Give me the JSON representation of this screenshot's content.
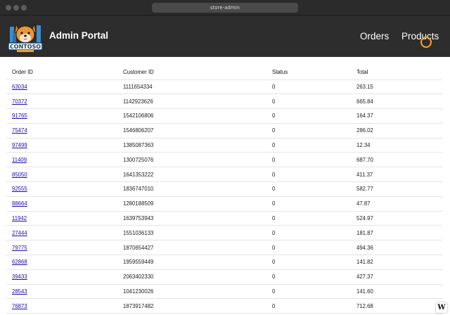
{
  "browser": {
    "address": "store-admin"
  },
  "header": {
    "logo_text": "CONTOSO",
    "title": "Admin Portal",
    "nav": {
      "orders": "Orders",
      "products": "Products"
    }
  },
  "table": {
    "columns": [
      "Order ID",
      "Customer ID",
      "Status",
      "Total"
    ],
    "rows": [
      {
        "order_id": "63034",
        "customer_id": "1111654334",
        "status": "0",
        "total": "263.15"
      },
      {
        "order_id": "70372",
        "customer_id": "1142923626",
        "status": "0",
        "total": "665.84"
      },
      {
        "order_id": "91765",
        "customer_id": "1542106806",
        "status": "0",
        "total": "164.37"
      },
      {
        "order_id": "75474",
        "customer_id": "1546806207",
        "status": "0",
        "total": "286.02"
      },
      {
        "order_id": "97499",
        "customer_id": "1385087363",
        "status": "0",
        "total": "12.34"
      },
      {
        "order_id": "11409",
        "customer_id": "1300725076",
        "status": "0",
        "total": "687.70"
      },
      {
        "order_id": "85050",
        "customer_id": "1641353222",
        "status": "0",
        "total": "411.37"
      },
      {
        "order_id": "92555",
        "customer_id": "1836747010",
        "status": "0",
        "total": "582.77"
      },
      {
        "order_id": "88664",
        "customer_id": "1280188509",
        "status": "0",
        "total": "47.87"
      },
      {
        "order_id": "11942",
        "customer_id": "1639753943",
        "status": "0",
        "total": "524.97"
      },
      {
        "order_id": "27444",
        "customer_id": "1551036133",
        "status": "0",
        "total": "181.87"
      },
      {
        "order_id": "79775",
        "customer_id": "1870654427",
        "status": "0",
        "total": "494.36"
      },
      {
        "order_id": "62868",
        "customer_id": "1959559449",
        "status": "0",
        "total": "141.82"
      },
      {
        "order_id": "39433",
        "customer_id": "2063402330",
        "status": "0",
        "total": "427.37"
      },
      {
        "order_id": "28543",
        "customer_id": "1041230026",
        "status": "0",
        "total": "141.60"
      },
      {
        "order_id": "76873",
        "customer_id": "1873917482",
        "status": "0",
        "total": "712.68"
      }
    ]
  },
  "badge": {
    "letter": "W"
  }
}
